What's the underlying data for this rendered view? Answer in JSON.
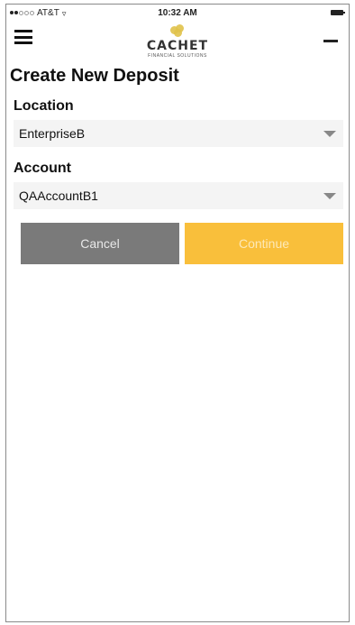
{
  "status_bar": {
    "carrier": "AT&T",
    "time": "10:32 AM"
  },
  "nav": {
    "logo_text": "CACHET",
    "logo_subtext": "FINANCIAL SOLUTIONS",
    "menu_icon": "hamburger-menu-icon",
    "minus_icon": "minus-icon"
  },
  "page": {
    "title": "Create New Deposit"
  },
  "form": {
    "location_label": "Location",
    "location_value": "EnterpriseB",
    "account_label": "Account",
    "account_value": "QAAccountB1",
    "cancel_label": "Cancel",
    "continue_label": "Continue"
  },
  "colors": {
    "cancel_button": "#7a7a7a",
    "continue_button": "#f9bf3b",
    "logo_accent": "#e0c24a"
  }
}
